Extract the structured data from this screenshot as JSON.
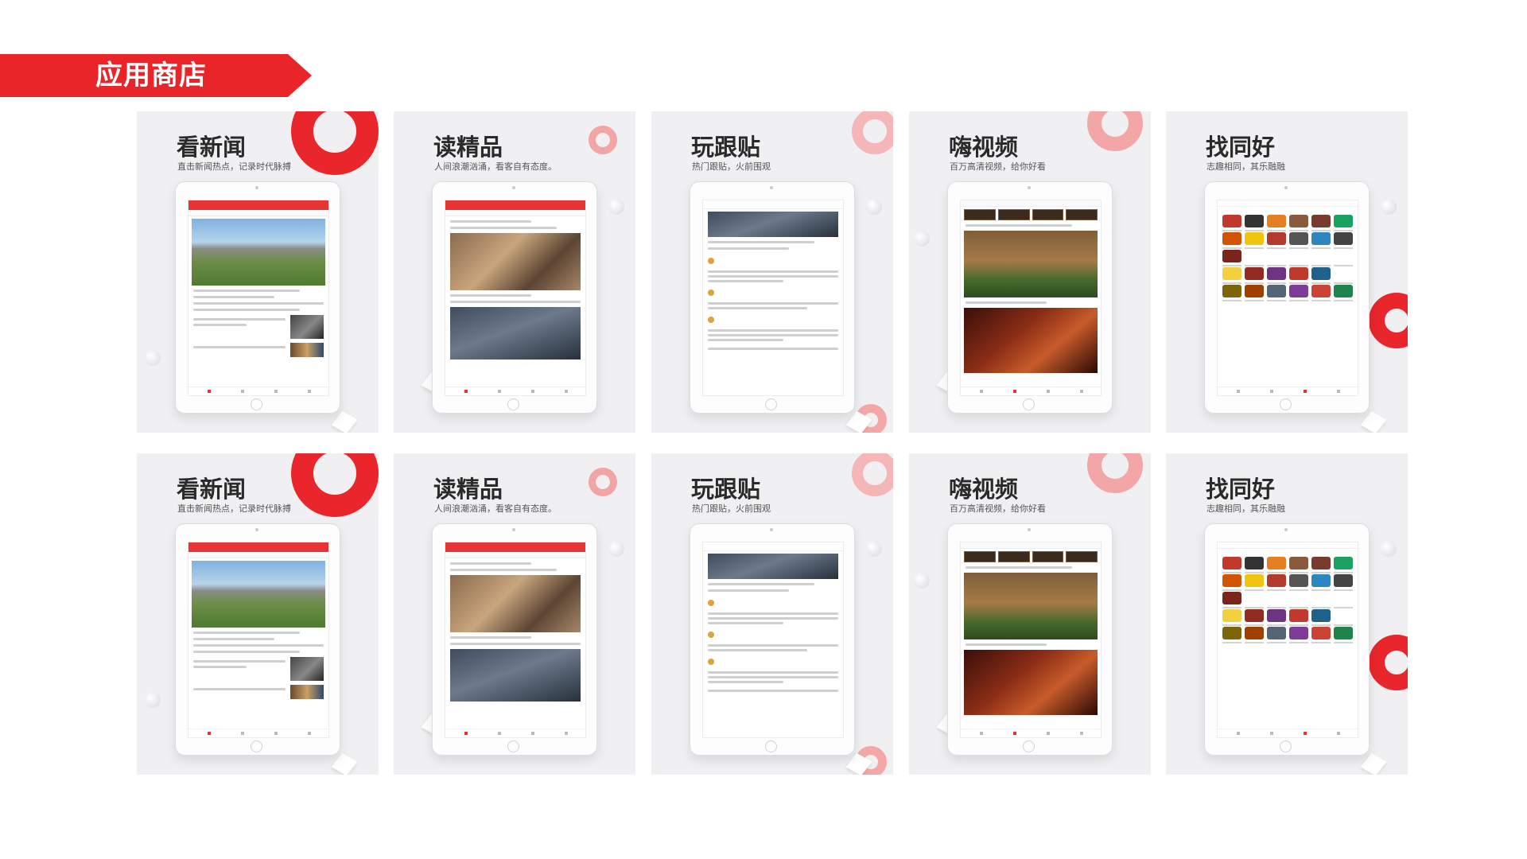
{
  "section_title": "应用商店",
  "cards": [
    {
      "title": "看新闻",
      "subtitle": "直击新闻热点，记录时代脉搏",
      "screen": "news"
    },
    {
      "title": "读精品",
      "subtitle": "人间浪潮汹涌，看客自有态度。",
      "screen": "read"
    },
    {
      "title": "玩跟贴",
      "subtitle": "热门跟贴，火前围观",
      "screen": "comments"
    },
    {
      "title": "嗨视频",
      "subtitle": "百万高清视频，给你好看",
      "screen": "video"
    },
    {
      "title": "找同好",
      "subtitle": "志趣相同，其乐融融",
      "screen": "community"
    },
    {
      "title": "看新闻",
      "subtitle": "直击新闻热点，记录时代脉搏",
      "screen": "news"
    },
    {
      "title": "读精品",
      "subtitle": "人间浪潮汹涌，看客自有态度。",
      "screen": "read"
    },
    {
      "title": "玩跟贴",
      "subtitle": "热门跟贴，火前围观",
      "screen": "comments"
    },
    {
      "title": "嗨视频",
      "subtitle": "百万高清视频，给你好看",
      "screen": "video"
    },
    {
      "title": "找同好",
      "subtitle": "志趣相同，其乐融融",
      "screen": "community"
    }
  ],
  "colors": {
    "brand_red": "#e9252a",
    "card_bg": "#f0f0f3"
  }
}
